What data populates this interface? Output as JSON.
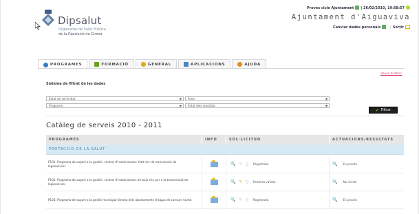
{
  "header": {
    "logo_title": "Dipsalut",
    "logo_sub1": "Organisme de Salut Pública",
    "logo_sub2": "de la Diputació de Girona",
    "user_line_prefix": "Proves cicle Ajuntament",
    "user_line_date": "| 26/02/2010, 19:58:57",
    "institution": "Ajuntament d'Aiguaviva",
    "change_data": "Canviar dades personals",
    "sortir": "Sortir",
    "separator": "|"
  },
  "tabs": [
    {
      "label": "PROGRAMES",
      "color": "#3a78c2"
    },
    {
      "label": "FORMACIÓ",
      "color": "#6aa31c"
    },
    {
      "label": "GENERAL",
      "color": "#e5a31b"
    },
    {
      "label": "APLICACIONS",
      "color": "#4b86c8"
    },
    {
      "label": "AJUDA",
      "color": "#e58a1b"
    }
  ],
  "veure_historic": "Veure històric",
  "filter": {
    "title": "Sistema de filtrat de les dades",
    "selects": [
      "Estat de sol·licitud",
      "Àrea",
      "Programa",
      "Estat dels resultats"
    ],
    "button": "Filtrar"
  },
  "catalog": {
    "title": "Catàleg de serveis 2010 - 2011",
    "columns": [
      "PROGRAMES",
      "INFO",
      "SOL·LICITUD",
      "ACTUACIONS/RESULTATS"
    ],
    "section": "PROTECCIÓ DE LA SALUT",
    "rows": [
      {
        "program": "P101. Programa de suport a la gestió i control d'instal·lacions d'alt risc de transmissió de legionel·losi",
        "solicitud": "Registrada",
        "resultat": "En procés",
        "pen_active": false
      },
      {
        "program": "P102. Programa de suport a la gestió i control d'instal·lacions de baix risc per a la transmissió de legionel·losi",
        "solicitud": "Pendent validar",
        "resultat": "No iniciat",
        "pen_active": true
      },
      {
        "program": "P103. Programa de suport a la gestió municipal directa dels abastaments d'aigua de consum humà",
        "solicitud": "Registrada",
        "resultat": "En procés",
        "pen_active": false
      }
    ]
  }
}
